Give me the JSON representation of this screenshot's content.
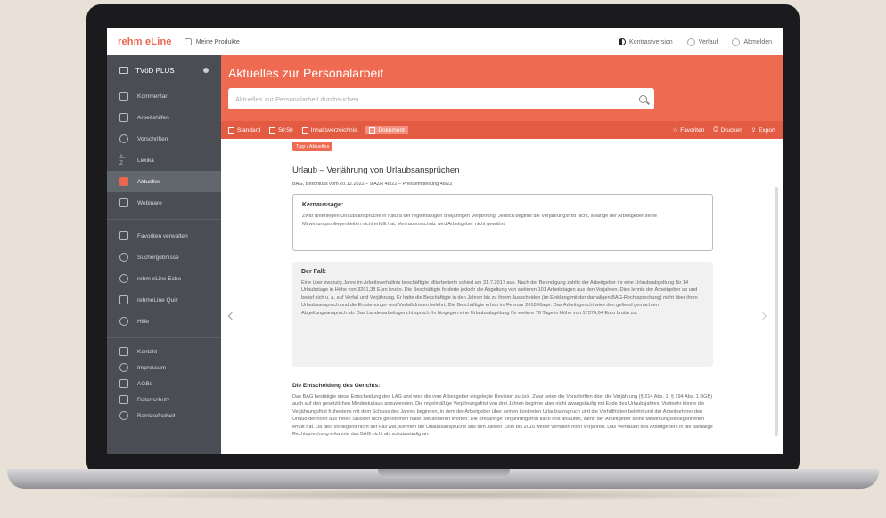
{
  "topbar": {
    "logo_main": "rehm",
    "logo_sub": "eLine",
    "my_products": "Meine Produkte",
    "contrast": "Kontrastversion",
    "history": "Verlauf",
    "logout": "Abmelden"
  },
  "sidebar": {
    "product": "TVöD PLUS",
    "items": [
      {
        "label": "Kommentar",
        "icon": "comment-icon"
      },
      {
        "label": "Arbeitshilfen",
        "icon": "tools-icon"
      },
      {
        "label": "Vorschriften",
        "icon": "paragraph-icon"
      },
      {
        "label": "Lexika",
        "icon": "az-icon"
      },
      {
        "label": "Aktuelles",
        "icon": "news-icon"
      },
      {
        "label": "Webinare",
        "icon": "webinar-icon"
      }
    ],
    "tools": [
      {
        "label": "Favoriten verwalten",
        "icon": "star-icon"
      },
      {
        "label": "Suchergebnisse",
        "icon": "search-icon"
      },
      {
        "label": "rehm eLine Echo",
        "icon": "echo-icon"
      },
      {
        "label": "rehmeLine Quiz",
        "icon": "crown-icon"
      },
      {
        "label": "Hilfe",
        "icon": "help-icon"
      }
    ],
    "footer": [
      {
        "label": "Kontakt",
        "icon": "mail-icon"
      },
      {
        "label": "Impressum",
        "icon": "info-icon"
      },
      {
        "label": "AGBs",
        "icon": "document-icon"
      },
      {
        "label": "Datenschutz",
        "icon": "shield-icon"
      },
      {
        "label": "Barrierefreiheit",
        "icon": "accessibility-icon"
      }
    ]
  },
  "header": {
    "title": "Aktuelles zur Personalarbeit",
    "search_placeholder": "Aktuelles zur Personalarbeit durchsuchen..."
  },
  "toolbar": {
    "standard": "Standard",
    "split": "50:50",
    "toc": "Inhaltsverzeichnis",
    "document": "Dokument",
    "favorites": "Favoriten",
    "print": "Drucken",
    "export": "Export"
  },
  "article": {
    "badge": "Tipp / Aktuelles",
    "title": "Urlaub – Verjährung von Urlaubsansprüchen",
    "meta": "BAG, Beschluss vom 20.12.2022 – 9 AZR 48/22 – Pressemitteilung 48/22",
    "key_title": "Kernaussage:",
    "key_text": "Zwar unterliegen Urlaubsansprüche in natura der regelmäßigen dreijährigen Verjährung. Jedoch beginnt die Verjährungsfrist nicht, solange der Arbeitgeber seine Mitwirkungsobliegenheiten nicht erfüllt hat. Vertrauensschutz wird Arbeitgeber nicht gewährt.",
    "case_title": "Der Fall:",
    "case_text": "Eine über zwanzig Jahre im Arbeitsverhältnis beschäftigte Mitarbeiterin schied am 31.7.2017 aus. Nach der Beendigung zahlte der Arbeitgeber ihr eine Urlaubsabgeltung für 14 Urlaubstage in Höhe von 3201,38 Euro brutto. Die Beschäftigte forderte jedoch die Abgeltung von weiteren 101 Arbeitstagen aus den Vorjahren. Dies lehnte der Arbeitgeber ab und berief sich u. a. auf Verfall und Verjährung. Er hatte die Beschäftigte in den Jahren bis zu ihrem Ausscheiden (im Einklang mit der damaligen BAG-Rechtsprechung) nicht über ihren Urlaubsanspruch und die Entstehungs- und Verfallsfristen belehrt. Die Beschäftigte erhob im Februar 2018 Klage. Das Arbeitsgericht wies den geltend gemachten Abgeltungsanspruch ab. Das Landesarbeitsgericht sprach ihr hingegen eine Urlaubsabgeltung für weitere 76 Tage in Höhe von 17376,64 Euro brutto zu.",
    "decision_title": "Die Entscheidung des Gerichts:",
    "decision_text": "Das BAG bestätigte diese Entscheidung des LAG und wies die vom Arbeitgeber eingelegte Revision zurück. Zwar seien die Vorschriften über die Verjährung (§ 214 Abs. 1, § 194 Abs. 1 BGB) auch auf den gesetzlichen Mindesturlaub anzuwenden. Die regelmäßige Verjährungsfrist von drei Jahren beginne aber nicht zwangsläufig mit Ende des Urlaubsjahres. Vielmehr könne die Verjährungsfrist frühestens mit dem Schluss des Jahres beginnen, in dem der Arbeitgeber über seinen konkreten Urlaubsanspruch und die Verfallfristen belehrt und der Arbeitnehmer den Urlaub dennoch aus freien Stücken nicht genommen habe. Mit anderen Worten: Die dreijährige Verjährungsfrist kann erst anlaufen, wenn der Arbeitgeber seine Mitwirkungsobliegenheiten erfüllt hat. Da dies vorliegend nicht der Fall war, konnten die Urlaubsansprüche aus den Jahren 1996 bis 2016 weder verfallen noch verjähren. Das Vertrauen des Arbeitgebers in die damalige Rechtsprechung erkannte das BAG nicht als schutzwürdig an."
  }
}
